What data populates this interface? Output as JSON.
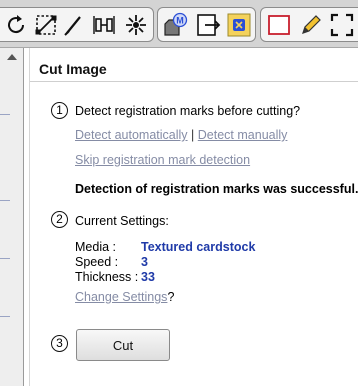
{
  "toolbar": {
    "icons": [
      "rotate-icon",
      "scale-icon",
      "line-icon",
      "align-icon",
      "weld-icon",
      "media-icon",
      "export-icon",
      "registration-icon",
      "rectangle-icon",
      "pencil-icon",
      "fullscreen-icon"
    ],
    "registration_icon_color": "#2b4fd6",
    "registration_bg": "#f4d25c",
    "media_badge": "M"
  },
  "panel": {
    "title": "Cut Image",
    "step1": {
      "number": "1",
      "prompt": "Detect registration marks before cutting?",
      "detect_auto": "Detect automatically",
      "separator": "|",
      "detect_manual": "Detect manually",
      "skip": "Skip registration mark detection",
      "status": "Detection of registration marks was successful."
    },
    "step2": {
      "number": "2",
      "heading": "Current Settings:",
      "media_label": "Media :",
      "media_value": "Textured cardstock",
      "speed_label": "Speed :",
      "speed_value": "3",
      "thickness_label": "Thickness :",
      "thickness_value": "33",
      "change_link": "Change Settings",
      "change_suffix": "?"
    },
    "step3": {
      "number": "3",
      "cut_label": "Cut"
    }
  },
  "colors": {
    "link": "#858ca5",
    "value": "#1f3aa8",
    "accent_red": "#c8202e",
    "accent_yellow": "#f2c230"
  }
}
